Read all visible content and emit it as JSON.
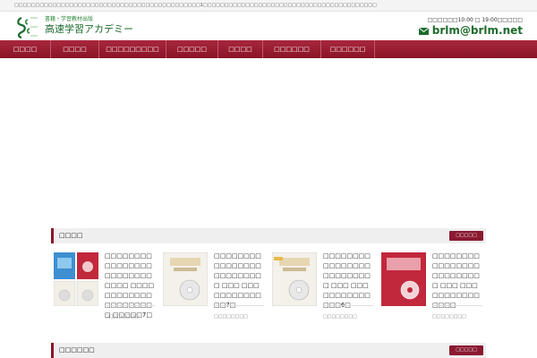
{
  "topbar": {
    "text": "□□□□□□□□□□□□□□□□□□□□□□□□□□□□□□□□□□□□□□□□□□□□1□□□□□□□□□□□□□□□□□□□□□□□□□□□□□□□□□□□□□□□□□"
  },
  "header": {
    "brand_sub": "書籍・学習教材出版",
    "brand_main": "高速学習アカデミー",
    "hours": "□□□□□□10:00 □ 19:00□□□□□",
    "email": "brlm@brlm.net"
  },
  "nav": {
    "items": [
      {
        "label": "□□□□"
      },
      {
        "label": "□□□□"
      },
      {
        "label": "□□□□□□□□□"
      },
      {
        "label": "□□□□□"
      },
      {
        "label": "□□□□"
      },
      {
        "label": "□□□□□□"
      },
      {
        "label": "□□□□□□"
      }
    ]
  },
  "section1": {
    "title": "□□□□",
    "more": "□□□□□",
    "products": [
      {
        "title": "□□□□□□□□□□□□□□□□□□□□□□□□□□□□ □□□□□□□□□□□□□□□□□□□□□ □□□□□7□",
        "date": "□□□□□□□□",
        "thumb": "multi"
      },
      {
        "title": "□□□□□□□□□□□□□□□□□□□□□□□□□ □□□ □□□□□□□□□□□□□7□",
        "date": "□□□□□□□□",
        "thumb": "cd-white"
      },
      {
        "title": "□□□□□□□□□□□□□□□□□□□□□□□□□ □□□ □□□□□□□□□□□□□□6□",
        "date": "□□□□□□□□",
        "thumb": "cd-white"
      },
      {
        "title": "□□□□□□□□□□□□□□□□□□□□□□□□□ □□□ □□□□□□□□□□□□□□□",
        "date": "□□□□□□□□",
        "thumb": "cd-red"
      }
    ]
  },
  "section2": {
    "title": "□□□□□□",
    "more": "□□□□□"
  },
  "colors": {
    "nav": "#8a1427",
    "brand": "#1c6a2d",
    "accent_btn": "#8a1a30"
  }
}
